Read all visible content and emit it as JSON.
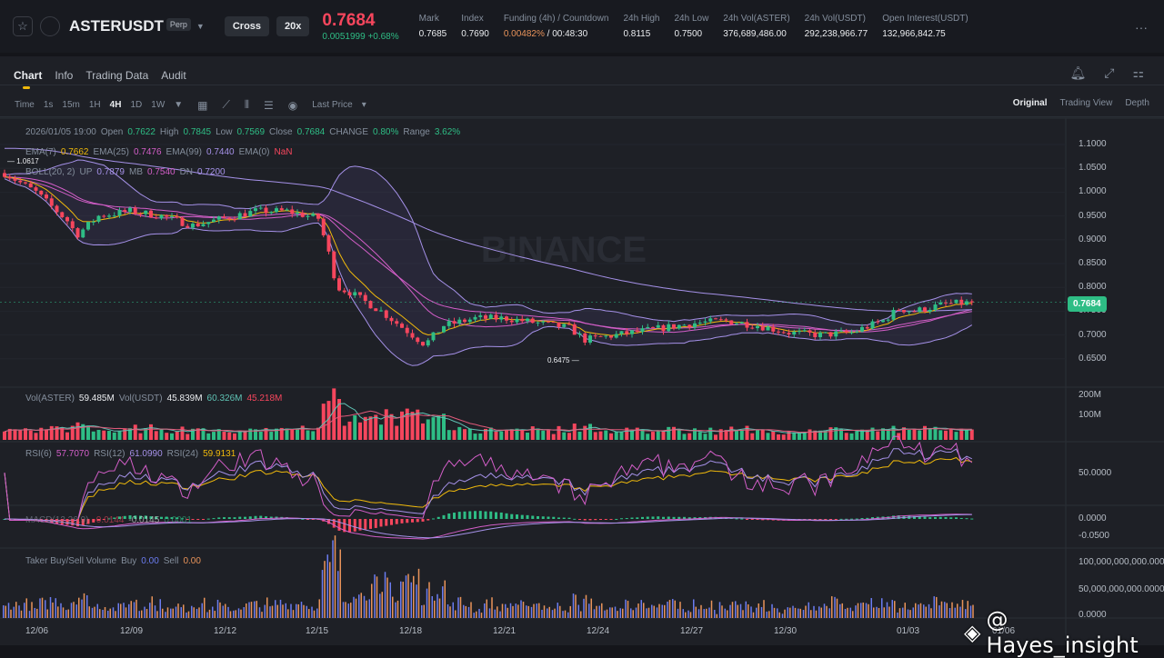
{
  "header": {
    "symbol": "ASTERUSDT",
    "contract": "Perp",
    "margin_mode": "Cross",
    "leverage": "20x",
    "last_price": "0.7684",
    "change": "0.0051999 +0.68%",
    "stats": [
      {
        "label": "Mark",
        "value": "0.7685"
      },
      {
        "label": "Index",
        "value": "0.7690"
      },
      {
        "label": "Funding (4h) / Countdown",
        "value": "0.00482%",
        "value2": " / 00:48:30"
      },
      {
        "label": "24h High",
        "value": "0.8115"
      },
      {
        "label": "24h Low",
        "value": "0.7500"
      },
      {
        "label": "24h Vol(ASTER)",
        "value": "376,689,486.00"
      },
      {
        "label": "24h Vol(USDT)",
        "value": "292,238,966.77"
      },
      {
        "label": "Open Interest(USDT)",
        "value": "132,966,842.75"
      }
    ],
    "more": "···"
  },
  "tabs": [
    "Chart",
    "Info",
    "Trading Data",
    "Audit"
  ],
  "toolbar": {
    "intervals": [
      "Time",
      "1s",
      "15m",
      "1H",
      "4H",
      "1D",
      "1W"
    ],
    "active": "4H",
    "price_type": "Last Price"
  },
  "views": [
    "Original",
    "Trading View",
    "Depth"
  ],
  "legend": {
    "ohlc": {
      "time": "2026/01/05 19:00",
      "open_l": "Open",
      "open": "0.7622",
      "high_l": "High",
      "high": "0.7845",
      "low_l": "Low",
      "low": "0.7569",
      "close_l": "Close",
      "close": "0.7684",
      "change_l": "CHANGE",
      "change": "0.80%",
      "range_l": "Range",
      "range": "3.62%"
    },
    "ema": {
      "l7": "EMA(7)",
      "v7": "0.7662",
      "l25": "EMA(25)",
      "v25": "0.7476",
      "l99": "EMA(99)",
      "v99": "0.7440",
      "l0": "EMA(0)",
      "v0": "NaN"
    },
    "boll": {
      "l": "BOLL(20, 2)",
      "up_l": "UP",
      "up": "0.7879",
      "mb_l": "MB",
      "mb": "0.7540",
      "dn_l": "DN",
      "dn": "0.7200"
    },
    "vol": {
      "l1": "Vol(ASTER)",
      "v1": "59.485M",
      "l2": "Vol(USDT)",
      "v2": "45.839M",
      "v3": "60.326M",
      "v4": "45.218M"
    },
    "rsi": {
      "l6": "RSI(6)",
      "v6": "57.7070",
      "l12": "RSI(12)",
      "v12": "61.0990",
      "l24": "RSI(24)",
      "v24": "59.9131"
    },
    "macd": {
      "l": "MACD(12,26,9)",
      "v1": "-0.0144",
      "v2": "-0.0145",
      "v3": "0.0001"
    },
    "taker": {
      "l": "Taker Buy/Sell Volume",
      "buy_l": "Buy",
      "buy": "0.00",
      "sell_l": "Sell",
      "sell": "0.00"
    }
  },
  "axes": {
    "price": [
      "1.1000",
      "1.0500",
      "1.0000",
      "0.9500",
      "0.9000",
      "0.8500",
      "0.8000",
      "0.7500",
      "0.7000",
      "0.6500"
    ],
    "current_price": "0.7684",
    "vol": [
      "200M",
      "100M"
    ],
    "rsi": [
      "50.0000"
    ],
    "macd": [
      "0.0000",
      "-0.0500"
    ],
    "taker": [
      "100,000,000,000.0000",
      "50,000,000,000.0000",
      "0.0000"
    ],
    "dates": [
      "12/06",
      "12/09",
      "12/12",
      "12/15",
      "12/18",
      "12/21",
      "12/24",
      "12/27",
      "12/30",
      "01/03",
      "01/06"
    ]
  },
  "markers": {
    "high": "1.0617",
    "low": "0.6475"
  },
  "watermark": "BINANCE",
  "credit": "@ Hayes_insight",
  "colors": {
    "up": "#2ebd85",
    "down": "#f6465d",
    "accent": "#f0b90b"
  },
  "price_path": [
    [
      0,
      1.04
    ],
    [
      1,
      1.0
    ],
    [
      2,
      0.94
    ],
    [
      2.3,
      0.91
    ],
    [
      3,
      0.95
    ],
    [
      4,
      0.96
    ],
    [
      5,
      0.95
    ],
    [
      6,
      0.93
    ],
    [
      7,
      0.945
    ],
    [
      8,
      0.96
    ],
    [
      9,
      0.96
    ],
    [
      10,
      0.945
    ],
    [
      10.3,
      0.88
    ],
    [
      10.6,
      0.8
    ],
    [
      11,
      0.79
    ],
    [
      12,
      0.75
    ],
    [
      13,
      0.7
    ],
    [
      13.4,
      0.68
    ],
    [
      14,
      0.72
    ],
    [
      15,
      0.735
    ],
    [
      16,
      0.735
    ],
    [
      17,
      0.725
    ],
    [
      18,
      0.715
    ],
    [
      18.5,
      0.69
    ],
    [
      19,
      0.695
    ],
    [
      20,
      0.705
    ],
    [
      21,
      0.715
    ],
    [
      22,
      0.725
    ],
    [
      23,
      0.73
    ],
    [
      24,
      0.72
    ],
    [
      25,
      0.705
    ],
    [
      26,
      0.7
    ],
    [
      27,
      0.705
    ],
    [
      28,
      0.73
    ],
    [
      28.5,
      0.755
    ],
    [
      29,
      0.75
    ],
    [
      30,
      0.765
    ],
    [
      31,
      0.7684
    ]
  ]
}
